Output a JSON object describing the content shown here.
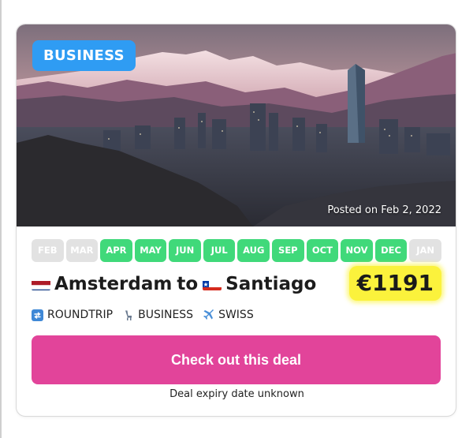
{
  "deal": {
    "category": "BUSINESS",
    "posted": "Posted on Feb 2, 2022",
    "origin": "Amsterdam",
    "connector": "to",
    "destination": "Santiago",
    "price": "€1191",
    "months": [
      {
        "label": "FEB",
        "available": false
      },
      {
        "label": "MAR",
        "available": false
      },
      {
        "label": "APR",
        "available": true
      },
      {
        "label": "MAY",
        "available": true
      },
      {
        "label": "JUN",
        "available": true
      },
      {
        "label": "JUL",
        "available": true
      },
      {
        "label": "AUG",
        "available": true
      },
      {
        "label": "SEP",
        "available": true
      },
      {
        "label": "OCT",
        "available": true
      },
      {
        "label": "NOV",
        "available": true
      },
      {
        "label": "DEC",
        "available": true
      },
      {
        "label": "JAN",
        "available": false
      }
    ],
    "meta": {
      "trip_type": "ROUNDTRIP",
      "cabin": "BUSINESS",
      "airline": "SWISS"
    },
    "cta_label": "Check out this deal",
    "expiry": "Deal expiry date unknown"
  },
  "icons": {
    "origin_flag": "netherlands-flag-icon",
    "destination_flag": "chile-flag-icon",
    "trip_type": "roundtrip-icon",
    "cabin": "seat-icon",
    "airline": "airplane-icon"
  },
  "colors": {
    "badge": "#2f9cf3",
    "month_available": "#40d97a",
    "month_unavailable": "#e2e2e2",
    "price_highlight": "#fbf23c",
    "cta": "#e2449a"
  }
}
